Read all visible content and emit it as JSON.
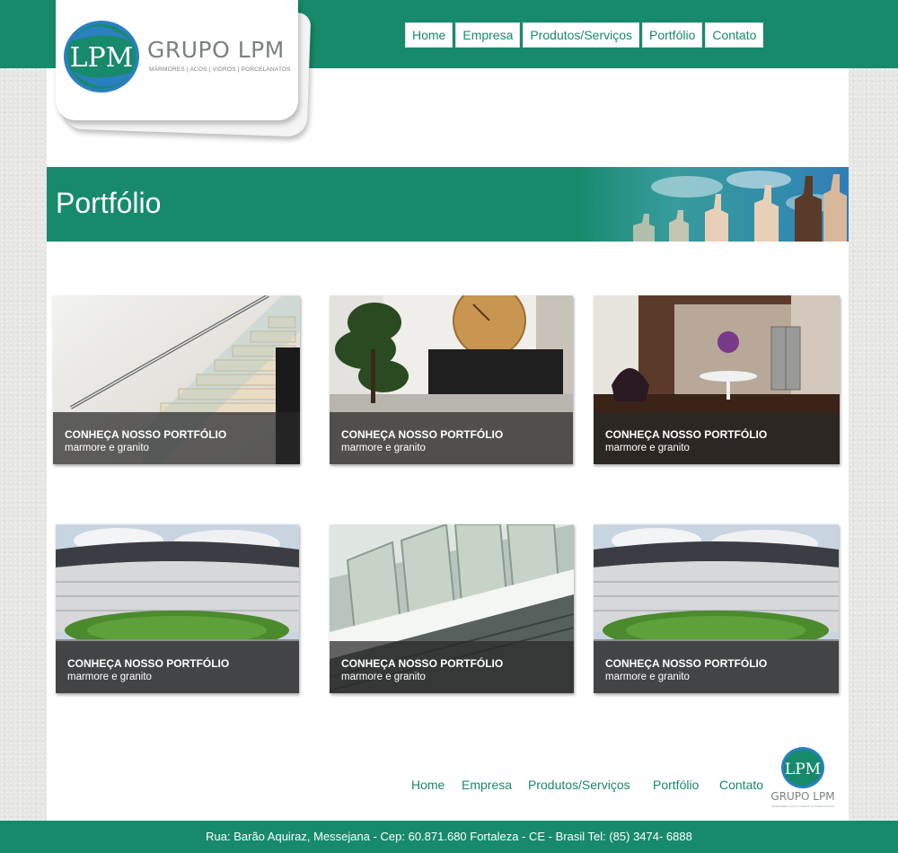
{
  "brand": {
    "name": "GRUPO LPM",
    "monogram": "LPM",
    "tagline": "MÁRMORES | ACOS | VIDROS | PORCELANATOS",
    "primary_color": "#178a6c",
    "accent_color": "#2a7fc0"
  },
  "nav": {
    "items": [
      "Home",
      "Empresa",
      "Produtos/Serviços",
      "Portfólio",
      "Contato"
    ]
  },
  "banner": {
    "title": "Portfólio"
  },
  "cards": [
    {
      "title": "CONHEÇA NOSSO PORTFÓLIO",
      "subtitle": "marmore e granito",
      "photo": "glass-staircase"
    },
    {
      "title": "CONHEÇA NOSSO PORTFÓLIO",
      "subtitle": "marmore e granito",
      "photo": "lobby-clock"
    },
    {
      "title": "CONHEÇA NOSSO PORTFÓLIO",
      "subtitle": "marmore e granito",
      "photo": "lobby-elevator"
    },
    {
      "title": "CONHEÇA NOSSO PORTFÓLIO",
      "subtitle": "marmore e granito",
      "photo": "stadium"
    },
    {
      "title": "CONHEÇA NOSSO PORTFÓLIO",
      "subtitle": "marmore e granito",
      "photo": "glass-facade"
    },
    {
      "title": "CONHEÇA NOSSO PORTFÓLIO",
      "subtitle": "marmore e granito",
      "photo": "stadium"
    }
  ],
  "footer": {
    "nav": [
      "Home",
      "Empresa",
      "Produtos/Serviços",
      "Portfólio",
      "Contato"
    ],
    "address": "Rua: Barão Aquiraz, Messejana - Cep: 60.871.680 Fortaleza - CE - Brasil Tel: (85) 3474- 6888"
  }
}
